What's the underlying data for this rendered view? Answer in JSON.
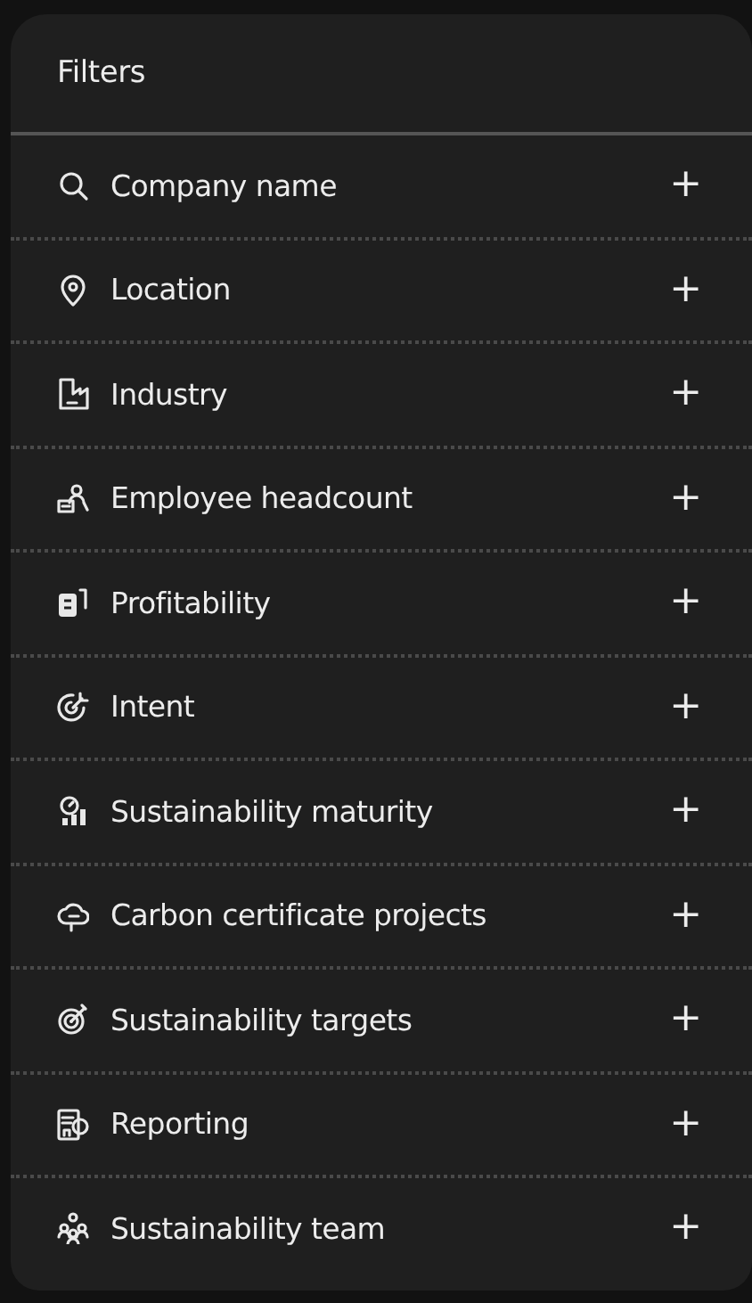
{
  "panel": {
    "title": "Filters"
  },
  "filters": [
    {
      "label": "Company name",
      "action": "+"
    },
    {
      "label": "Location",
      "action": "+"
    },
    {
      "label": "Industry",
      "action": "+"
    },
    {
      "label": "Employee headcount",
      "action": "+"
    },
    {
      "label": "Profitability",
      "action": "+"
    },
    {
      "label": "Intent",
      "action": "+"
    },
    {
      "label": "Sustainability maturity",
      "action": "+"
    },
    {
      "label": "Carbon certificate projects",
      "action": "+"
    },
    {
      "label": "Sustainability targets",
      "action": "+"
    },
    {
      "label": "Reporting",
      "action": "+"
    },
    {
      "label": "Sustainability team",
      "action": "+"
    }
  ]
}
